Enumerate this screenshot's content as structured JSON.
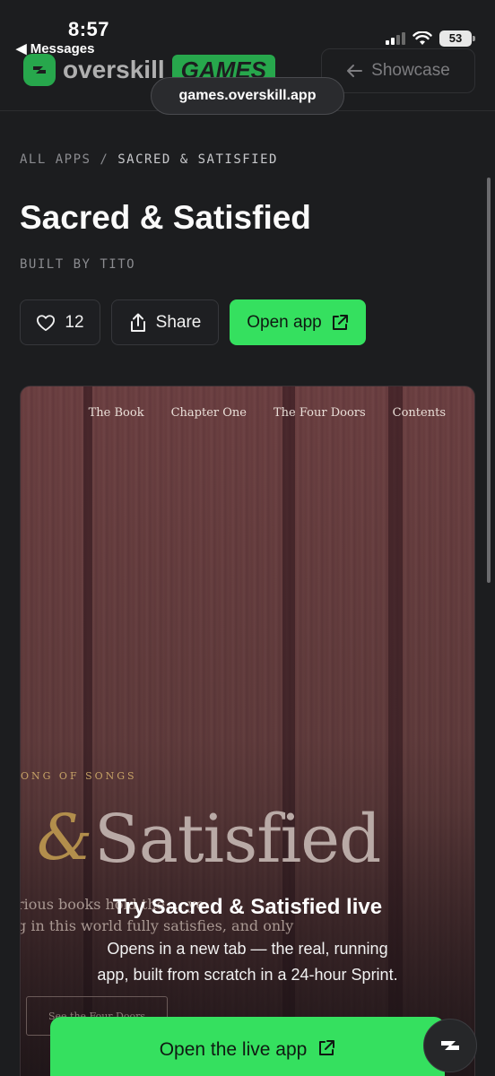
{
  "status_bar": {
    "time": "8:57",
    "back_label": "◀ Messages",
    "battery": "53"
  },
  "header": {
    "logo_text": "overskill",
    "logo_badge": "GAMES",
    "showcase_label": "Showcase"
  },
  "browser": {
    "url": "games.overskill.app"
  },
  "breadcrumb": {
    "root": "ALL APPS",
    "separator": "/",
    "current": "SACRED & SATISFIED"
  },
  "app": {
    "title": "Sacred & Satisfied",
    "author": "BUILT BY TITO",
    "likes": "12",
    "share_label": "Share",
    "open_label": "Open app"
  },
  "preview": {
    "nav": [
      "The Book",
      "Chapter One",
      "The Four Doors",
      "Contents"
    ],
    "eyebrow": "ONG OF SONGS",
    "hero_amp": "&",
    "hero_word": "Satisfied",
    "body_line1": "rious books hold the ... ye",
    "body_line2": "g in this world fully satisfies, and only",
    "ghost_link": "See the Four Doors"
  },
  "live": {
    "title": "Try Sacred & Satisfied live",
    "subtitle_line1": "Opens in a new tab — the real, running",
    "subtitle_line2": "app, built from scratch in a 24-hour Sprint.",
    "button_label": "Open the live app"
  },
  "colors": {
    "accent": "#35e05f",
    "background": "#1c1d1f"
  }
}
